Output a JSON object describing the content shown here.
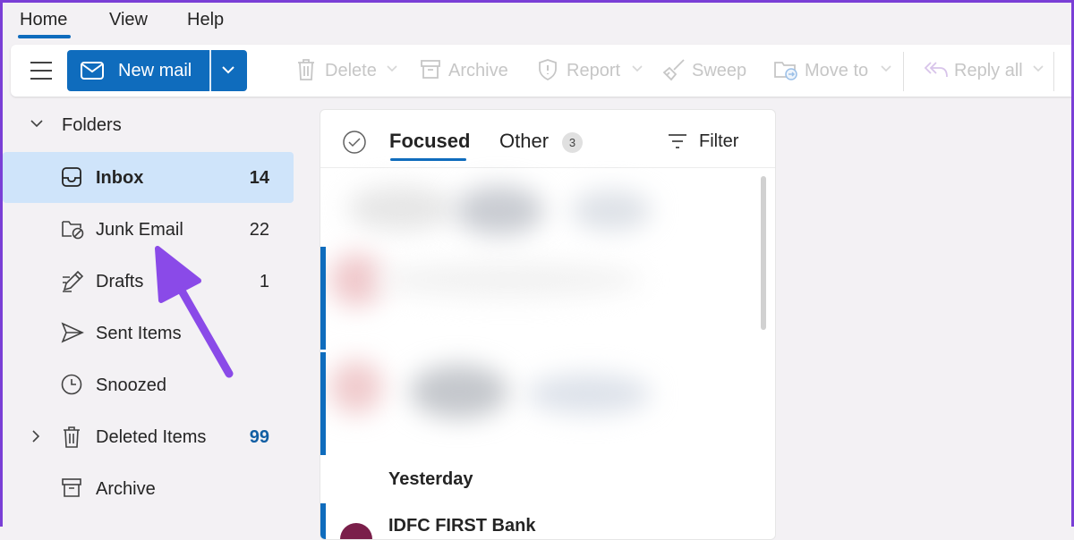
{
  "top_tabs": {
    "home": "Home",
    "view": "View",
    "help": "Help"
  },
  "ribbon": {
    "new_mail": "New mail",
    "delete": "Delete",
    "archive": "Archive",
    "report": "Report",
    "sweep": "Sweep",
    "move_to": "Move to",
    "reply_all": "Reply all"
  },
  "folders": {
    "header": "Folders",
    "items": [
      {
        "name": "Inbox",
        "count": "14",
        "icon": "inbox-icon"
      },
      {
        "name": "Junk Email",
        "count": "22",
        "icon": "junk-icon"
      },
      {
        "name": "Drafts",
        "count": "1",
        "icon": "pencil-icon"
      },
      {
        "name": "Sent Items",
        "count": "",
        "icon": "send-icon"
      },
      {
        "name": "Snoozed",
        "count": "",
        "icon": "clock-icon"
      },
      {
        "name": "Deleted Items",
        "count": "99",
        "icon": "trash-icon"
      },
      {
        "name": "Archive",
        "count": "",
        "icon": "archive-icon"
      }
    ]
  },
  "message_list": {
    "tab_focused": "Focused",
    "tab_other": "Other",
    "other_count": "3",
    "filter": "Filter",
    "group_yesterday": "Yesterday",
    "next_sender": "IDFC FIRST Bank"
  },
  "colors": {
    "accent": "#0f6cbd",
    "selected_bg": "#cfe4fa",
    "annotation_arrow": "#8a4ae8"
  }
}
